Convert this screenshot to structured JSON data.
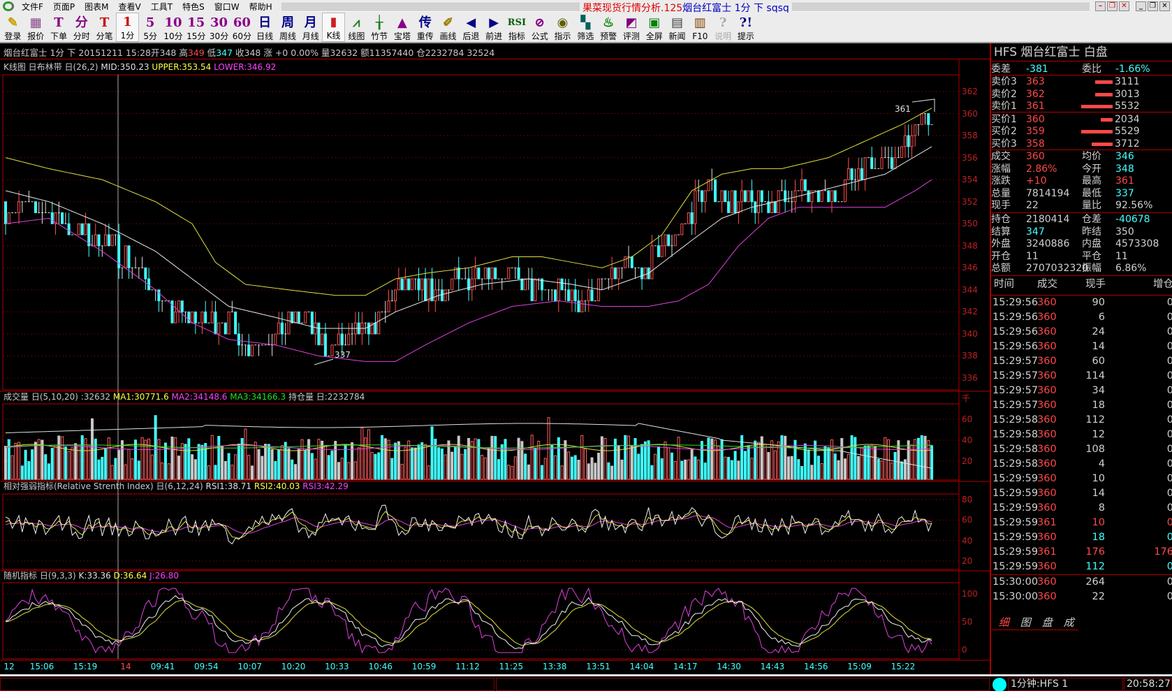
{
  "window": {
    "title_app": "果菜现货行情分析.125",
    "title_doc": "烟台红富士 1分 下 sqsq",
    "controls": [
      "minimize",
      "restore",
      "close"
    ]
  },
  "menu": [
    "文件F",
    "页面P",
    "图表M",
    "查看V",
    "工具T",
    "特色S",
    "窗口W",
    "帮助H"
  ],
  "toolbar": [
    {
      "glyph": "✎",
      "label": "登录",
      "color": "#c8a000"
    },
    {
      "glyph": "▦",
      "label": "报价",
      "color": "#884488"
    },
    {
      "glyph": "T",
      "label": "下单",
      "color": "#880088"
    },
    {
      "glyph": "分",
      "label": "分时",
      "color": "#880088"
    },
    {
      "glyph": "T",
      "label": "分笔",
      "color": "#cc0000"
    },
    {
      "glyph": "1",
      "label": "1分",
      "color": "#cc0000",
      "selected": true
    },
    {
      "glyph": "5",
      "label": "5分",
      "color": "#880088"
    },
    {
      "glyph": "10",
      "label": "10分",
      "color": "#880088"
    },
    {
      "glyph": "15",
      "label": "15分",
      "color": "#880088"
    },
    {
      "glyph": "30",
      "label": "30分",
      "color": "#880088"
    },
    {
      "glyph": "60",
      "label": "60分",
      "color": "#880088"
    },
    {
      "glyph": "日",
      "label": "日线",
      "color": "#000088"
    },
    {
      "glyph": "周",
      "label": "周线",
      "color": "#000088"
    },
    {
      "glyph": "月",
      "label": "月线",
      "color": "#000088"
    },
    {
      "glyph": "▮",
      "label": "K线",
      "color": "#cc2020",
      "selected": true
    },
    {
      "glyph": "⩘",
      "label": "线图",
      "color": "#208020"
    },
    {
      "glyph": "╁",
      "label": "竹节",
      "color": "#208020"
    },
    {
      "glyph": "▲",
      "label": "宝塔",
      "color": "#880088"
    },
    {
      "glyph": "传",
      "label": "重传",
      "color": "#000088"
    },
    {
      "glyph": "✐",
      "label": "画线",
      "color": "#a08000"
    },
    {
      "glyph": "◀",
      "label": "后退",
      "color": "#000088"
    },
    {
      "glyph": "▶",
      "label": "前进",
      "color": "#000088"
    },
    {
      "glyph": "RSI",
      "label": "指标",
      "color": "#006000"
    },
    {
      "glyph": "⊘",
      "label": "公式",
      "color": "#880088"
    },
    {
      "glyph": "◉",
      "label": "指示",
      "color": "#606000"
    },
    {
      "glyph": "▚",
      "label": "筛选",
      "color": "#006060"
    },
    {
      "glyph": "♨",
      "label": "预警",
      "color": "#008000"
    },
    {
      "glyph": "◩",
      "label": "评测",
      "color": "#800080"
    },
    {
      "glyph": "▣",
      "label": "全屏",
      "color": "#008000"
    },
    {
      "glyph": "▤",
      "label": "新闻",
      "color": "#404040"
    },
    {
      "glyph": "▥",
      "label": "F10",
      "color": "#804000"
    },
    {
      "glyph": "?",
      "label": "说明",
      "color": "#aaaaaa",
      "disabled": true
    },
    {
      "glyph": "?!",
      "label": "提示",
      "color": "#000088"
    }
  ],
  "infoline": {
    "name": "烟台红富士 1分 下 20151211 15:28开348 高",
    "high": "349",
    "low_label": "低",
    "low": "347",
    "rest": "收348 涨 +0 0.00% 量32632 额11357440 仓2232784 32524"
  },
  "kline_header": {
    "label": "K线图 日布林带 日(26,2)",
    "mid": "MID:350.23",
    "upper": "UPPER:353.54",
    "lower": "LOWER:346.92"
  },
  "volume_header": {
    "label": "成交量 日(5,10,20) :32632",
    "ma1": "MA1:30771.6",
    "ma2": "MA2:34148.6",
    "ma3": "MA3:34166.3",
    "oi": "持仓量 日:2232784",
    "unit": "千"
  },
  "rsi_header": {
    "label": "相对强弱指标(Relative Strenth Index) 日(6,12,24)",
    "rsi1": "RSI1:38.71",
    "rsi2": "RSI2:40.03",
    "rsi3": "RSI3:42.29"
  },
  "kdj_header": {
    "label": "随机指标 日(9,3,3)",
    "k": "K:33.36",
    "d": "D:36.64",
    "j": "J:26.80"
  },
  "chart_data": {
    "type": "candlestick",
    "price_ticks": [
      336,
      338,
      340,
      342,
      344,
      346,
      348,
      350,
      352,
      354,
      356,
      358,
      360,
      362
    ],
    "annotations": {
      "high": "361",
      "low": "337"
    },
    "close_keypoints": [
      [
        0,
        351.5
      ],
      [
        13,
        351
      ],
      [
        22,
        349
      ],
      [
        29,
        348.5
      ],
      [
        36,
        347
      ],
      [
        43,
        345
      ],
      [
        49,
        342
      ],
      [
        58,
        341.5
      ],
      [
        67,
        341
      ],
      [
        72,
        339
      ],
      [
        81,
        340
      ],
      [
        90,
        341.5
      ],
      [
        94,
        339
      ],
      [
        101,
        339
      ],
      [
        108,
        340.5
      ],
      [
        112,
        341
      ],
      [
        117,
        344
      ],
      [
        126,
        344
      ],
      [
        135,
        344.5
      ],
      [
        143,
        346
      ],
      [
        152,
        345
      ],
      [
        157,
        344
      ],
      [
        166,
        344
      ],
      [
        173,
        343
      ],
      [
        179,
        344.5
      ],
      [
        186,
        346
      ],
      [
        191,
        345
      ],
      [
        197,
        348
      ],
      [
        204,
        350
      ],
      [
        209,
        353
      ],
      [
        215,
        352.5
      ],
      [
        224,
        351.5
      ],
      [
        231,
        352
      ],
      [
        238,
        353
      ],
      [
        247,
        352
      ],
      [
        253,
        354
      ],
      [
        260,
        356
      ],
      [
        267,
        356
      ],
      [
        271,
        358
      ],
      [
        278,
        360
      ]
    ],
    "bollinger_upper": [
      [
        0,
        356
      ],
      [
        13,
        355
      ],
      [
        29,
        354
      ],
      [
        45,
        352
      ],
      [
        56,
        350
      ],
      [
        63,
        346.5
      ],
      [
        72,
        344.5
      ],
      [
        85,
        344
      ],
      [
        99,
        343.5
      ],
      [
        108,
        343.5
      ],
      [
        117,
        345
      ],
      [
        126,
        345.5
      ],
      [
        139,
        346
      ],
      [
        152,
        347
      ],
      [
        161,
        347
      ],
      [
        179,
        346
      ],
      [
        188,
        347
      ],
      [
        197,
        349
      ],
      [
        206,
        353
      ],
      [
        215,
        354.5
      ],
      [
        224,
        355
      ],
      [
        233,
        355
      ],
      [
        247,
        356
      ],
      [
        258,
        357.5
      ],
      [
        269,
        359
      ],
      [
        278,
        360.5
      ]
    ],
    "bollinger_mid": [
      [
        0,
        353
      ],
      [
        13,
        352
      ],
      [
        29,
        350
      ],
      [
        45,
        347.5
      ],
      [
        56,
        345
      ],
      [
        67,
        342.5
      ],
      [
        81,
        341.5
      ],
      [
        94,
        340.5
      ],
      [
        108,
        340.5
      ],
      [
        117,
        342
      ],
      [
        130,
        343.5
      ],
      [
        143,
        344.5
      ],
      [
        157,
        345
      ],
      [
        170,
        344.5
      ],
      [
        179,
        344
      ],
      [
        193,
        345.5
      ],
      [
        206,
        348.5
      ],
      [
        215,
        350.5
      ],
      [
        224,
        351.5
      ],
      [
        238,
        352.5
      ],
      [
        251,
        353.5
      ],
      [
        264,
        354.5
      ],
      [
        278,
        357
      ]
    ],
    "bollinger_lower": [
      [
        0,
        350
      ],
      [
        13,
        350.5
      ],
      [
        29,
        347.5
      ],
      [
        45,
        344
      ],
      [
        56,
        341
      ],
      [
        67,
        339.5
      ],
      [
        81,
        339
      ],
      [
        94,
        338
      ],
      [
        108,
        337.5
      ],
      [
        117,
        337.5
      ],
      [
        126,
        339
      ],
      [
        139,
        341
      ],
      [
        152,
        342.5
      ],
      [
        166,
        343
      ],
      [
        179,
        342.5
      ],
      [
        193,
        342.5
      ],
      [
        202,
        343
      ],
      [
        211,
        344.5
      ],
      [
        220,
        348
      ],
      [
        229,
        350.5
      ],
      [
        238,
        351.5
      ],
      [
        251,
        351.5
      ],
      [
        264,
        351.5
      ],
      [
        273,
        353
      ],
      [
        278,
        354
      ]
    ],
    "volume_ticks": [
      20,
      40,
      60
    ],
    "rsi_ticks": [
      20,
      40,
      60,
      80
    ],
    "kdj_ticks": [
      0,
      50,
      100
    ],
    "time_labels": [
      {
        "t": "12",
        "color": "#40ffff"
      },
      {
        "t": "15:06"
      },
      {
        "t": "15:19"
      },
      {
        "t": "14",
        "color": "#ff4848"
      },
      {
        "t": "09:41"
      },
      {
        "t": "09:54"
      },
      {
        "t": "10:07"
      },
      {
        "t": "10:20"
      },
      {
        "t": "10:33"
      },
      {
        "t": "10:46"
      },
      {
        "t": "10:59"
      },
      {
        "t": "11:12"
      },
      {
        "t": "11:25"
      },
      {
        "t": "13:38"
      },
      {
        "t": "13:51"
      },
      {
        "t": "14:04"
      },
      {
        "t": "14:17"
      },
      {
        "t": "14:30"
      },
      {
        "t": "14:43"
      },
      {
        "t": "14:56"
      },
      {
        "t": "15:09"
      },
      {
        "t": "15:22"
      }
    ]
  },
  "quote": {
    "title": "HFS  烟台红富士   白盘",
    "weicha": {
      "label": "委差",
      "value": "-381",
      "label2": "委比",
      "value2": "-1.66%"
    },
    "asks": [
      {
        "label": "卖价3",
        "price": "363",
        "vol": "3111",
        "volnum": 3111
      },
      {
        "label": "卖价2",
        "price": "362",
        "vol": "3013",
        "volnum": 3013
      },
      {
        "label": "卖价1",
        "price": "361",
        "vol": "5532",
        "volnum": 5532
      }
    ],
    "bids": [
      {
        "label": "买价1",
        "price": "360",
        "vol": "2034",
        "volnum": 2034
      },
      {
        "label": "买价2",
        "price": "359",
        "vol": "5529",
        "volnum": 5529
      },
      {
        "label": "买价3",
        "price": "358",
        "vol": "3712",
        "volnum": 3712
      }
    ],
    "stats": [
      {
        "l1": "成交",
        "v1": "360",
        "c1": "#ff4848",
        "l2": "均价",
        "v2": "346",
        "c2": "#40ffff"
      },
      {
        "l1": "涨幅",
        "v1": "2.86%",
        "c1": "#ff4848",
        "l2": "今开",
        "v2": "348",
        "c2": "#40ffff"
      },
      {
        "l1": "涨跌",
        "v1": "+10",
        "c1": "#ff4848",
        "l2": "最高",
        "v2": "361",
        "c2": "#ff4848"
      },
      {
        "l1": "总量",
        "v1": "7814194",
        "c1": "#d0d0d0",
        "l2": "最低",
        "v2": "337",
        "c2": "#40ffff"
      },
      {
        "l1": "现手",
        "v1": "22",
        "c1": "#d0d0d0",
        "l2": "量比",
        "v2": "92.56%",
        "c2": "#d0d0d0"
      }
    ],
    "stats2": [
      {
        "l1": "持仓",
        "v1": "2180414",
        "c1": "#d0d0d0",
        "l2": "仓差",
        "v2": "-40678",
        "c2": "#40ffff"
      },
      {
        "l1": "结算",
        "v1": "347",
        "c1": "#40ffff",
        "l2": "昨结",
        "v2": "350",
        "c2": "#d0d0d0"
      },
      {
        "l1": "外盘",
        "v1": "3240886",
        "c1": "#d0d0d0",
        "l2": "内盘",
        "v2": "4573308",
        "c2": "#d0d0d0"
      },
      {
        "l1": "开仓",
        "v1": "11",
        "c1": "#d0d0d0",
        "l2": "平仓",
        "v2": "11",
        "c2": "#d0d0d0"
      },
      {
        "l1": "总额",
        "v1": "2707032320",
        "c1": "#d0d0d0",
        "l2": "振幅",
        "v2": "6.86%",
        "c2": "#d0d0d0"
      }
    ]
  },
  "ticks": {
    "headers": [
      "时间",
      "成交",
      "现手",
      "增仓"
    ],
    "rows": [
      {
        "time": "15:29:56",
        "price": "360",
        "vol": "90",
        "oi": "0",
        "c": "#d0d0d0"
      },
      {
        "time": "15:29:56",
        "price": "360",
        "vol": "6",
        "oi": "0",
        "c": "#d0d0d0"
      },
      {
        "time": "15:29:56",
        "price": "360",
        "vol": "24",
        "oi": "0",
        "c": "#d0d0d0"
      },
      {
        "time": "15:29:56",
        "price": "360",
        "vol": "14",
        "oi": "0",
        "c": "#d0d0d0"
      },
      {
        "time": "15:29:57",
        "price": "360",
        "vol": "60",
        "oi": "0",
        "c": "#d0d0d0"
      },
      {
        "time": "15:29:57",
        "price": "360",
        "vol": "114",
        "oi": "0",
        "c": "#d0d0d0"
      },
      {
        "time": "15:29:57",
        "price": "360",
        "vol": "34",
        "oi": "0",
        "c": "#d0d0d0"
      },
      {
        "time": "15:29:57",
        "price": "360",
        "vol": "18",
        "oi": "0",
        "c": "#d0d0d0"
      },
      {
        "time": "15:29:58",
        "price": "360",
        "vol": "112",
        "oi": "0",
        "c": "#d0d0d0"
      },
      {
        "time": "15:29:58",
        "price": "360",
        "vol": "12",
        "oi": "0",
        "c": "#d0d0d0"
      },
      {
        "time": "15:29:58",
        "price": "360",
        "vol": "108",
        "oi": "0",
        "c": "#d0d0d0"
      },
      {
        "time": "15:29:58",
        "price": "360",
        "vol": "4",
        "oi": "0",
        "c": "#d0d0d0"
      },
      {
        "time": "15:29:59",
        "price": "360",
        "vol": "10",
        "oi": "0",
        "c": "#d0d0d0"
      },
      {
        "time": "15:29:59",
        "price": "360",
        "vol": "14",
        "oi": "0",
        "c": "#d0d0d0"
      },
      {
        "time": "15:29:59",
        "price": "360",
        "vol": "8",
        "oi": "0",
        "c": "#d0d0d0"
      },
      {
        "time": "15:29:59",
        "price": "361",
        "vol": "10",
        "oi": "0",
        "c": "#ff4848"
      },
      {
        "time": "15:29:59",
        "price": "360",
        "vol": "18",
        "oi": "0",
        "c": "#40ffff"
      },
      {
        "time": "15:29:59",
        "price": "361",
        "vol": "176",
        "oi": "176",
        "c": "#ff4848"
      },
      {
        "time": "15:29:59",
        "price": "360",
        "vol": "112",
        "oi": "0",
        "c": "#40ffff"
      },
      {
        "time": "15:30:00",
        "price": "360",
        "vol": "264",
        "oi": "0",
        "c": "#d0d0d0"
      },
      {
        "time": "15:30:00",
        "price": "360",
        "vol": "22",
        "oi": "0",
        "c": "#d0d0d0"
      }
    ]
  },
  "tabs": [
    "细",
    "图",
    "盘",
    "成"
  ],
  "status": {
    "label": "1分钟:HFS 1",
    "time": "20:58:27",
    "indicator_color": "#00ffff"
  }
}
